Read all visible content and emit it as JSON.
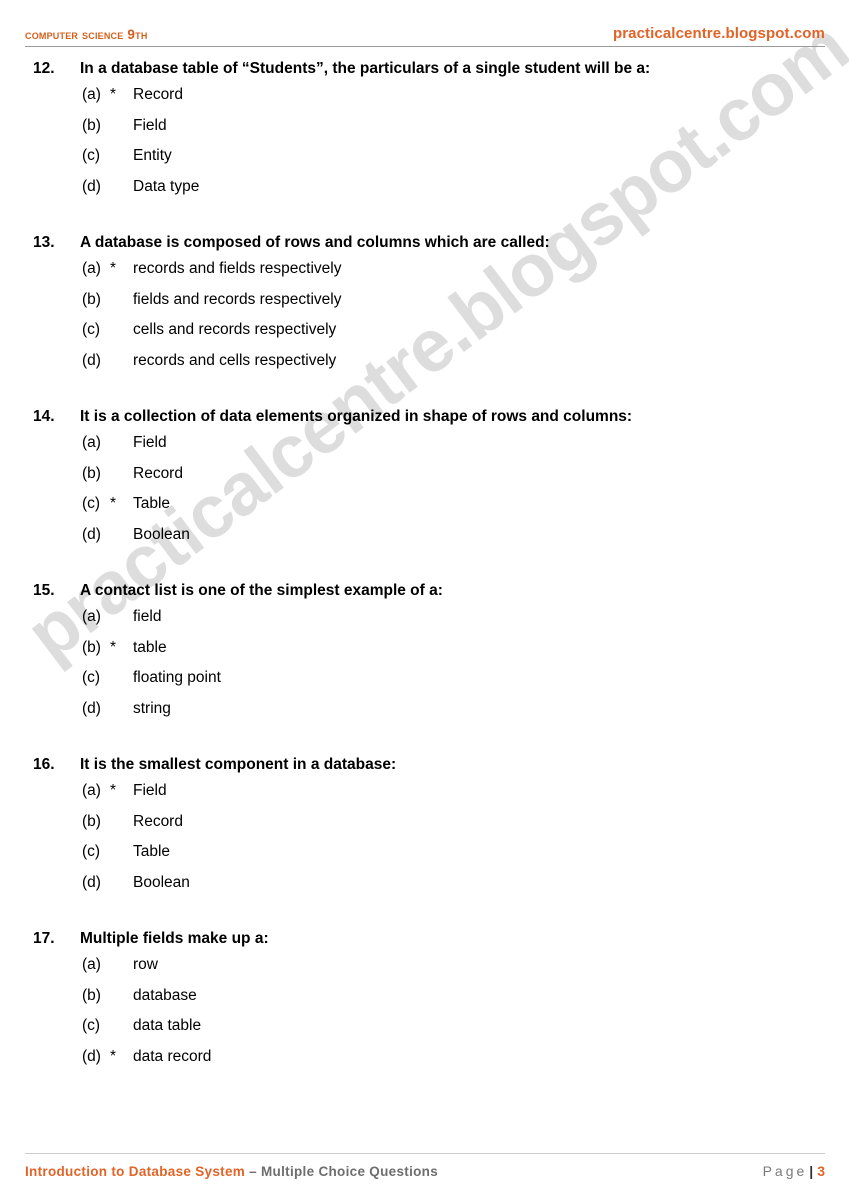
{
  "header": {
    "left_title": "Computer Science 9th",
    "right_site": "practicalcentre.blogspot.com",
    "accent_color": "#e06327",
    "rule_color": "#9a9a9a"
  },
  "watermark": {
    "text": "practicalcentre.blogspot.com",
    "color": "#dddddd",
    "rotation_deg": -37
  },
  "questions": [
    {
      "number": "12.",
      "text": "In a database table of “Students”, the particulars of a single student will be a:",
      "options": [
        {
          "letter": "(a)",
          "marker": "*",
          "text": "Record"
        },
        {
          "letter": "(b)",
          "marker": "",
          "text": "Field"
        },
        {
          "letter": "(c)",
          "marker": "",
          "text": "Entity"
        },
        {
          "letter": "(d)",
          "marker": "",
          "text": "Data type"
        }
      ]
    },
    {
      "number": "13.",
      "text": "A database is composed of rows and columns which are called:",
      "options": [
        {
          "letter": "(a)",
          "marker": "*",
          "text": "records and fields respectively"
        },
        {
          "letter": "(b)",
          "marker": "",
          "text": "fields and records respectively"
        },
        {
          "letter": "(c)",
          "marker": "",
          "text": "cells and records respectively"
        },
        {
          "letter": "(d)",
          "marker": "",
          "text": "records and cells respectively"
        }
      ]
    },
    {
      "number": "14.",
      "text": "It is a collection of data elements organized in shape of rows and columns:",
      "options": [
        {
          "letter": "(a)",
          "marker": "",
          "text": "Field"
        },
        {
          "letter": "(b)",
          "marker": "",
          "text": "Record"
        },
        {
          "letter": "(c)",
          "marker": "*",
          "text": "Table"
        },
        {
          "letter": "(d)",
          "marker": "",
          "text": "Boolean"
        }
      ]
    },
    {
      "number": "15.",
      "text": "A contact list is one of the simplest example of a:",
      "options": [
        {
          "letter": "(a)",
          "marker": "",
          "text": "field"
        },
        {
          "letter": "(b)",
          "marker": "*",
          "text": "table"
        },
        {
          "letter": "(c)",
          "marker": "",
          "text": "floating point"
        },
        {
          "letter": "(d)",
          "marker": "",
          "text": "string"
        }
      ]
    },
    {
      "number": "16.",
      "text": "It is the smallest component in a database:",
      "options": [
        {
          "letter": "(a)",
          "marker": "*",
          "text": "Field"
        },
        {
          "letter": "(b)",
          "marker": "",
          "text": "Record"
        },
        {
          "letter": "(c)",
          "marker": "",
          "text": "Table"
        },
        {
          "letter": "(d)",
          "marker": "",
          "text": "Boolean"
        }
      ]
    },
    {
      "number": "17.",
      "text": "Multiple fields make up a:",
      "options": [
        {
          "letter": "(a)",
          "marker": "",
          "text": "row"
        },
        {
          "letter": "(b)",
          "marker": "",
          "text": "database"
        },
        {
          "letter": "(c)",
          "marker": "",
          "text": "data table"
        },
        {
          "letter": "(d)",
          "marker": "*",
          "text": "data record"
        }
      ]
    }
  ],
  "footer": {
    "title": "Introduction to Database System",
    "subtitle": " – Multiple Choice Questions",
    "page_word": "Page",
    "page_separator": "|",
    "page_number": "3"
  }
}
